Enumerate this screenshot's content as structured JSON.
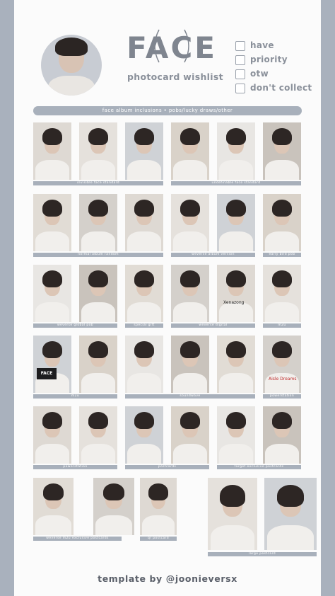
{
  "header": {
    "logo_text": "FACE",
    "subtitle": "photocard wishlist"
  },
  "legend": [
    {
      "label": "have"
    },
    {
      "label": "priority"
    },
    {
      "label": "otw"
    },
    {
      "label": "don't collect"
    }
  ],
  "banner": "face album inclusions • pobs/lucky draws/other",
  "sections": [
    {
      "label": "invisible face standard"
    },
    {
      "label": "undefinable face standard"
    },
    {
      "label": "normal album random"
    },
    {
      "label": "weverse album version"
    },
    {
      "label": "early bird pob"
    },
    {
      "label": "weverse global pob"
    },
    {
      "label": "special gift"
    },
    {
      "label": "weverse digital"
    },
    {
      "label": "m2u"
    },
    {
      "label": "m2u"
    },
    {
      "label": "soundwave"
    },
    {
      "label": "powerstation"
    },
    {
      "label": "powerstation"
    },
    {
      "label": "postcards"
    },
    {
      "label": "target exclusive postcards"
    },
    {
      "label": "weverse m2u exclusive postcards"
    },
    {
      "label": "qr postcard"
    },
    {
      "label": "large postcard"
    }
  ],
  "card_texts": {
    "face_album": "FACE",
    "handwriting": "Xenazong",
    "signature": "Aisle Dreams"
  },
  "credit": "template by @joonieversx",
  "colors": {
    "frame": "#a9b1bd",
    "paper": "#fbfbfb",
    "bar": "#a8b0bb",
    "text": "#8a909a"
  }
}
